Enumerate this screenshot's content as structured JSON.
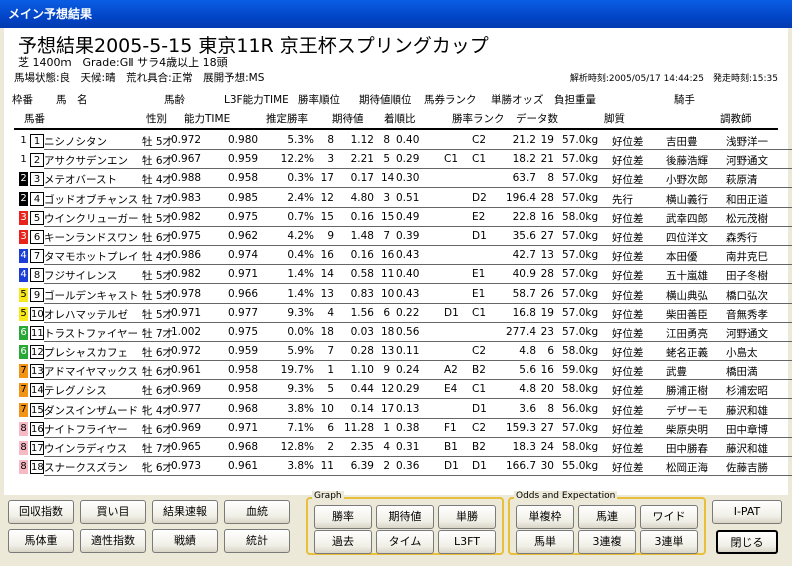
{
  "window_title": "メイン予想結果",
  "heading": "予想結果2005-5-15 東京11R 京王杯スプリングカップ",
  "race_info": "芝 1400ｍ　Grade:GⅡ サラ4歳以上 18頭",
  "conditions": "馬場状態:良　天候:晴　荒れ具合:正常　展開予想:MS",
  "analysis_time": "解析時刻:2005/05/17 14:44:25",
  "start_time": "発走時刻:15:35",
  "header1": [
    "枠番",
    "馬　名",
    "馬齢",
    "L3F能力TIME",
    "勝率順位",
    "期待値順位",
    "馬券ランク",
    "単勝オッズ",
    "負担重量",
    "騎手"
  ],
  "header2": [
    "馬番",
    "性別",
    "能力TIME",
    "推定勝率",
    "期待値",
    "着順比",
    "勝率ランク",
    "データ数",
    "脚質",
    "調教師"
  ],
  "rows": [
    {
      "waku": "1",
      "num": "1",
      "name": "ニシノシタン",
      "age": "牡 5才",
      "t1": "0.972",
      "t2": "0.980",
      "rate": "5.3%",
      "wr": "8",
      "ev": "1.12",
      "er": "8",
      "ratio": "0.40",
      "mr": "",
      "rr": "C2",
      "odds": "21.2",
      "n": "19",
      "w": "57.0kg",
      "style": "好位差",
      "jockey": "吉田豊",
      "trainer": "浅野洋一"
    },
    {
      "waku": "1",
      "num": "2",
      "name": "アサクサデンエン",
      "age": "牡 6才",
      "t1": "0.967",
      "t2": "0.959",
      "rate": "12.2%",
      "wr": "3",
      "ev": "2.21",
      "er": "5",
      "ratio": "0.29",
      "mr": "C1",
      "rr": "C1",
      "odds": "18.2",
      "n": "21",
      "w": "57.0kg",
      "style": "好位差",
      "jockey": "後藤浩輝",
      "trainer": "河野通文"
    },
    {
      "waku": "2",
      "num": "3",
      "name": "メテオバースト",
      "age": "牡 4才",
      "t1": "0.988",
      "t2": "0.958",
      "rate": "0.3%",
      "wr": "17",
      "ev": "0.17",
      "er": "14",
      "ratio": "0.30",
      "mr": "",
      "rr": "",
      "odds": "63.7",
      "n": "8",
      "w": "57.0kg",
      "style": "好位差",
      "jockey": "小野次郎",
      "trainer": "萩原清"
    },
    {
      "waku": "2",
      "num": "4",
      "name": "ゴッドオブチャンス",
      "age": "牡 7才",
      "t1": "0.983",
      "t2": "0.985",
      "rate": "2.4%",
      "wr": "12",
      "ev": "4.80",
      "er": "3",
      "ratio": "0.51",
      "mr": "",
      "rr": "D2",
      "odds": "196.4",
      "n": "28",
      "w": "57.0kg",
      "style": "先行",
      "jockey": "横山義行",
      "trainer": "和田正道"
    },
    {
      "waku": "3",
      "num": "5",
      "name": "ウインクリューガー",
      "age": "牡 5才",
      "t1": "0.982",
      "t2": "0.975",
      "rate": "0.7%",
      "wr": "15",
      "ev": "0.16",
      "er": "15",
      "ratio": "0.49",
      "mr": "",
      "rr": "E2",
      "odds": "22.8",
      "n": "16",
      "w": "58.0kg",
      "style": "好位差",
      "jockey": "武幸四郎",
      "trainer": "松元茂樹"
    },
    {
      "waku": "3",
      "num": "6",
      "name": "キーンランドスワン",
      "age": "牡 6才",
      "t1": "0.975",
      "t2": "0.962",
      "rate": "4.2%",
      "wr": "9",
      "ev": "1.48",
      "er": "7",
      "ratio": "0.39",
      "mr": "",
      "rr": "D1",
      "odds": "35.6",
      "n": "27",
      "w": "57.0kg",
      "style": "好位差",
      "jockey": "四位洋文",
      "trainer": "森秀行"
    },
    {
      "waku": "4",
      "num": "7",
      "name": "タマモホットプレイ",
      "age": "牡 4才",
      "t1": "0.986",
      "t2": "0.974",
      "rate": "0.4%",
      "wr": "16",
      "ev": "0.16",
      "er": "16",
      "ratio": "0.43",
      "mr": "",
      "rr": "",
      "odds": "42.7",
      "n": "13",
      "w": "57.0kg",
      "style": "好位差",
      "jockey": "本田優",
      "trainer": "南井克巳"
    },
    {
      "waku": "4",
      "num": "8",
      "name": "フジサイレンス",
      "age": "牡 5才",
      "t1": "0.982",
      "t2": "0.971",
      "rate": "1.4%",
      "wr": "14",
      "ev": "0.58",
      "er": "11",
      "ratio": "0.40",
      "mr": "",
      "rr": "E1",
      "odds": "40.9",
      "n": "28",
      "w": "57.0kg",
      "style": "好位差",
      "jockey": "五十嵐雄",
      "trainer": "田子冬樹"
    },
    {
      "waku": "5",
      "num": "9",
      "name": "ゴールデンキャスト",
      "age": "牡 5才",
      "t1": "0.978",
      "t2": "0.966",
      "rate": "1.4%",
      "wr": "13",
      "ev": "0.83",
      "er": "10",
      "ratio": "0.43",
      "mr": "",
      "rr": "E1",
      "odds": "58.7",
      "n": "26",
      "w": "57.0kg",
      "style": "好位差",
      "jockey": "横山典弘",
      "trainer": "橋口弘次"
    },
    {
      "waku": "5",
      "num": "10",
      "name": "オレハマッテルゼ",
      "age": "牡 5才",
      "t1": "0.971",
      "t2": "0.977",
      "rate": "9.3%",
      "wr": "4",
      "ev": "1.56",
      "er": "6",
      "ratio": "0.22",
      "mr": "D1",
      "rr": "C1",
      "odds": "16.8",
      "n": "19",
      "w": "57.0kg",
      "style": "好位差",
      "jockey": "柴田善臣",
      "trainer": "音無秀孝"
    },
    {
      "waku": "6",
      "num": "11",
      "name": "トラストファイヤー",
      "age": "牡 7才",
      "t1": "1.002",
      "t2": "0.975",
      "rate": "0.0%",
      "wr": "18",
      "ev": "0.03",
      "er": "18",
      "ratio": "0.56",
      "mr": "",
      "rr": "",
      "odds": "277.4",
      "n": "23",
      "w": "57.0kg",
      "style": "好位差",
      "jockey": "江田勇亮",
      "trainer": "河野通文"
    },
    {
      "waku": "6",
      "num": "12",
      "name": "プレシャスカフェ",
      "age": "牡 6才",
      "t1": "0.972",
      "t2": "0.959",
      "rate": "5.9%",
      "wr": "7",
      "ev": "0.28",
      "er": "13",
      "ratio": "0.11",
      "mr": "",
      "rr": "C2",
      "odds": "4.8",
      "n": "6",
      "w": "58.0kg",
      "style": "好位差",
      "jockey": "蛯名正義",
      "trainer": "小島太"
    },
    {
      "waku": "7",
      "num": "13",
      "name": "アドマイヤマックス",
      "age": "牡 6才",
      "t1": "0.961",
      "t2": "0.958",
      "rate": "19.7%",
      "wr": "1",
      "ev": "1.10",
      "er": "9",
      "ratio": "0.24",
      "mr": "A2",
      "rr": "B2",
      "odds": "5.6",
      "n": "16",
      "w": "59.0kg",
      "style": "好位差",
      "jockey": "武豊",
      "trainer": "橋田満"
    },
    {
      "waku": "7",
      "num": "14",
      "name": "テレグノシス",
      "age": "牡 6才",
      "t1": "0.969",
      "t2": "0.958",
      "rate": "9.3%",
      "wr": "5",
      "ev": "0.44",
      "er": "12",
      "ratio": "0.29",
      "mr": "E4",
      "rr": "C1",
      "odds": "4.8",
      "n": "20",
      "w": "58.0kg",
      "style": "好位差",
      "jockey": "勝浦正樹",
      "trainer": "杉浦宏昭"
    },
    {
      "waku": "7",
      "num": "15",
      "name": "ダンスインザムード",
      "age": "牝 4才",
      "t1": "0.977",
      "t2": "0.968",
      "rate": "3.8%",
      "wr": "10",
      "ev": "0.14",
      "er": "17",
      "ratio": "0.13",
      "mr": "",
      "rr": "D1",
      "odds": "3.6",
      "n": "8",
      "w": "56.0kg",
      "style": "好位差",
      "jockey": "デザーモ",
      "trainer": "藤沢和雄"
    },
    {
      "waku": "8",
      "num": "16",
      "name": "ナイトフライヤー",
      "age": "牡 6才",
      "t1": "0.969",
      "t2": "0.971",
      "rate": "7.1%",
      "wr": "6",
      "ev": "11.28",
      "er": "1",
      "ratio": "0.38",
      "mr": "F1",
      "rr": "C2",
      "odds": "159.3",
      "n": "27",
      "w": "57.0kg",
      "style": "好位差",
      "jockey": "柴原央明",
      "trainer": "田中章博"
    },
    {
      "waku": "8",
      "num": "17",
      "name": "ウインラディウス",
      "age": "牡 7才",
      "t1": "0.965",
      "t2": "0.968",
      "rate": "12.8%",
      "wr": "2",
      "ev": "2.35",
      "er": "4",
      "ratio": "0.31",
      "mr": "B1",
      "rr": "B2",
      "odds": "18.3",
      "n": "24",
      "w": "58.0kg",
      "style": "好位差",
      "jockey": "田中勝春",
      "trainer": "藤沢和雄"
    },
    {
      "waku": "8",
      "num": "18",
      "name": "スナークスズラン",
      "age": "牝 6才",
      "t1": "0.973",
      "t2": "0.961",
      "rate": "3.8%",
      "wr": "11",
      "ev": "6.39",
      "er": "2",
      "ratio": "0.36",
      "mr": "D1",
      "rr": "D1",
      "odds": "166.7",
      "n": "30",
      "w": "55.0kg",
      "style": "好位差",
      "jockey": "松岡正海",
      "trainer": "佐藤吉勝"
    }
  ],
  "waku_colors": {
    "1": "#ffffff",
    "2": "#000000",
    "3": "#e8231c",
    "4": "#1b3fd6",
    "5": "#f7e81c",
    "6": "#29a838",
    "7": "#f29416",
    "8": "#f7b9c4"
  },
  "left_buttons": [
    "回収指数",
    "買い目",
    "結果速報",
    "血統",
    "馬体重",
    "適性指数",
    "戦績",
    "統計"
  ],
  "graph_label": "Graph",
  "graph_buttons": [
    "勝率",
    "期待値",
    "単勝",
    "過去",
    "タイム",
    "L3FT"
  ],
  "odds_label": "Odds and Expectation",
  "odds_buttons": [
    "単複枠",
    "馬連",
    "ワイド",
    "馬単",
    "3連複",
    "3連単"
  ],
  "ipat_label": "I-PAT",
  "close_label": "閉じる"
}
